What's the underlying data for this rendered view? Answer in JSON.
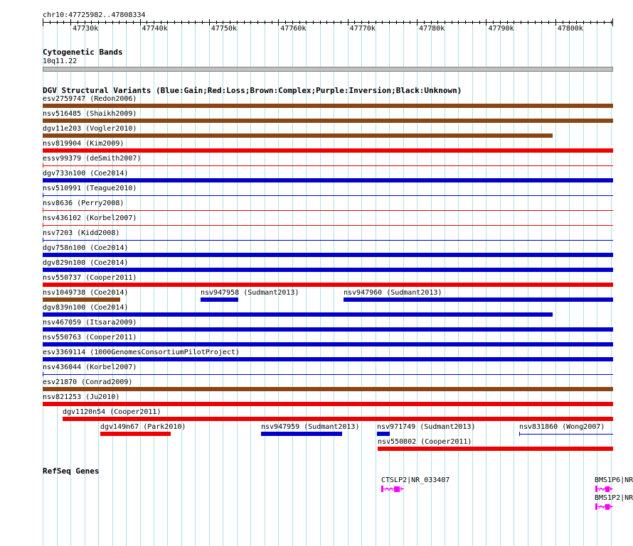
{
  "coords": "chr10:47725982..47808334",
  "ruler": {
    "start": 47725982,
    "end": 47808334,
    "ticks": [
      {
        "pos": 47730000,
        "label": "47730k"
      },
      {
        "pos": 47740000,
        "label": "47740k"
      },
      {
        "pos": 47750000,
        "label": "47750k"
      },
      {
        "pos": 47760000,
        "label": "47760k"
      },
      {
        "pos": 47770000,
        "label": "47770k"
      },
      {
        "pos": 47780000,
        "label": "47780k"
      },
      {
        "pos": 47790000,
        "label": "47790k"
      },
      {
        "pos": 47800000,
        "label": "47800k"
      }
    ]
  },
  "cytoband": {
    "title": "Cytogenetic Bands",
    "band": "10q11.22",
    "color": "#c0c0c0"
  },
  "colors": {
    "gain": "#0000cc",
    "loss": "#ee0000",
    "complex": "#8b4513",
    "gene": "#ff00ff",
    "grid": "#aee0e8"
  },
  "dgv": {
    "title": "DGV Structural Variants (Blue:Gain;Red:Loss;Brown:Complex;Purple:Inversion;Black:Unknown)",
    "rows": [
      [
        {
          "label": "esv2759747 (Redon2006)",
          "start": 47725982,
          "end": 47808334,
          "type": "complex",
          "thick": true
        }
      ],
      [
        {
          "label": "nsv516485 (Shaikh2009)",
          "start": 47725982,
          "end": 47808334,
          "type": "complex",
          "thick": true
        }
      ],
      [
        {
          "label": "dgv11e203 (Vogler2010)",
          "start": 47725982,
          "end": 47799600,
          "type": "complex",
          "thick": true
        }
      ],
      [
        {
          "label": "nsv819904 (Kim2009)",
          "start": 47725982,
          "end": 47808334,
          "type": "loss",
          "thick": true
        }
      ],
      [
        {
          "label": "essv99379 (deSmith2007)",
          "start": 47725982,
          "end": 47808334,
          "type": "loss",
          "thick": false
        }
      ],
      [
        {
          "label": "dgv733n100 (Coe2014)",
          "start": 47725982,
          "end": 47808334,
          "type": "gain",
          "thick": true
        }
      ],
      [
        {
          "label": "nsv510991 (Teague2010)",
          "start": 47725982,
          "end": 47808334,
          "type": "gain",
          "thick": false
        }
      ],
      [
        {
          "label": "nsv8636 (Perry2008)",
          "start": 47725982,
          "end": 47808334,
          "type": "loss",
          "thick": false
        }
      ],
      [
        {
          "label": "nsv436102 (Korbel2007)",
          "start": 47725982,
          "end": 47808334,
          "type": "loss",
          "thick": false
        }
      ],
      [
        {
          "label": "nsv7203 (Kidd2008)",
          "start": 47725982,
          "end": 47808334,
          "type": "gain",
          "thick": false
        }
      ],
      [
        {
          "label": "dgv758n100 (Coe2014)",
          "start": 47725982,
          "end": 47808334,
          "type": "gain",
          "thick": true
        }
      ],
      [
        {
          "label": "dgv829n100 (Coe2014)",
          "start": 47725982,
          "end": 47808334,
          "type": "gain",
          "thick": true
        }
      ],
      [
        {
          "label": "nsv550737 (Cooper2011)",
          "start": 47725982,
          "end": 47808334,
          "type": "loss",
          "thick": true
        }
      ],
      [
        {
          "label": "nsv1049738 (Coe2014)",
          "start": 47725982,
          "end": 47737200,
          "type": "complex",
          "thick": true
        },
        {
          "label": "nsv947958 (Sudmant2013)",
          "start": 47748800,
          "end": 47754200,
          "type": "gain",
          "thick": true
        },
        {
          "label": "nsv947960 (Sudmant2013)",
          "start": 47769400,
          "end": 47808334,
          "type": "gain",
          "thick": true
        }
      ],
      [
        {
          "label": "dgv839n100 (Coe2014)",
          "start": 47725982,
          "end": 47799600,
          "type": "gain",
          "thick": true
        }
      ],
      [
        {
          "label": "nsv467059 (Itsara2009)",
          "start": 47725982,
          "end": 47808334,
          "type": "gain",
          "thick": true
        }
      ],
      [
        {
          "label": "nsv550763 (Cooper2011)",
          "start": 47725982,
          "end": 47808334,
          "type": "gain",
          "thick": true
        }
      ],
      [
        {
          "label": "esv3369114 (1000GenomesConsortiumPilotProject)",
          "start": 47725982,
          "end": 47808334,
          "type": "gain",
          "thick": true
        }
      ],
      [
        {
          "label": "nsv436044 (Korbel2007)",
          "start": 47725982,
          "end": 47808334,
          "type": "gain",
          "thick": false
        }
      ],
      [
        {
          "label": "esv21870 (Conrad2009)",
          "start": 47725982,
          "end": 47808334,
          "type": "complex",
          "thick": true
        }
      ],
      [
        {
          "label": "nsv821253 (Ju2010)",
          "start": 47725982,
          "end": 47808334,
          "type": "loss",
          "thick": true
        }
      ],
      [
        {
          "label": "dgv1120n54 (Cooper2011)",
          "start": 47728900,
          "end": 47808334,
          "type": "loss",
          "thick": true
        }
      ],
      [
        {
          "label": "dgv149n67 (Park2010)",
          "start": 47734300,
          "end": 47744500,
          "type": "loss",
          "thick": true
        },
        {
          "label": "nsv947959 (Sudmant2013)",
          "start": 47757500,
          "end": 47769200,
          "type": "gain",
          "thick": true
        },
        {
          "label": "nsv971749 (Sudmant2013)",
          "start": 47774200,
          "end": 47776100,
          "type": "gain",
          "thick": true
        },
        {
          "label": "nsv831860 (Wong2007)",
          "start": 47794800,
          "end": 47808334,
          "type": "gain",
          "thick": false
        }
      ],
      [
        {
          "label": "nsv550802 (Cooper2011)",
          "start": 47774300,
          "end": 47808334,
          "type": "loss",
          "thick": true
        }
      ]
    ]
  },
  "refseq": {
    "title": "RefSeq Genes",
    "genes": [
      {
        "label": "CTSLP2|NR_033407",
        "start": 47774900,
        "end": 47778100,
        "row": 0
      },
      {
        "label": "BMS1P6|NR",
        "start": 47805800,
        "end": 47808334,
        "row": 0
      },
      {
        "label": "BMS1P2|NR",
        "start": 47805800,
        "end": 47808334,
        "row": 1
      }
    ]
  }
}
